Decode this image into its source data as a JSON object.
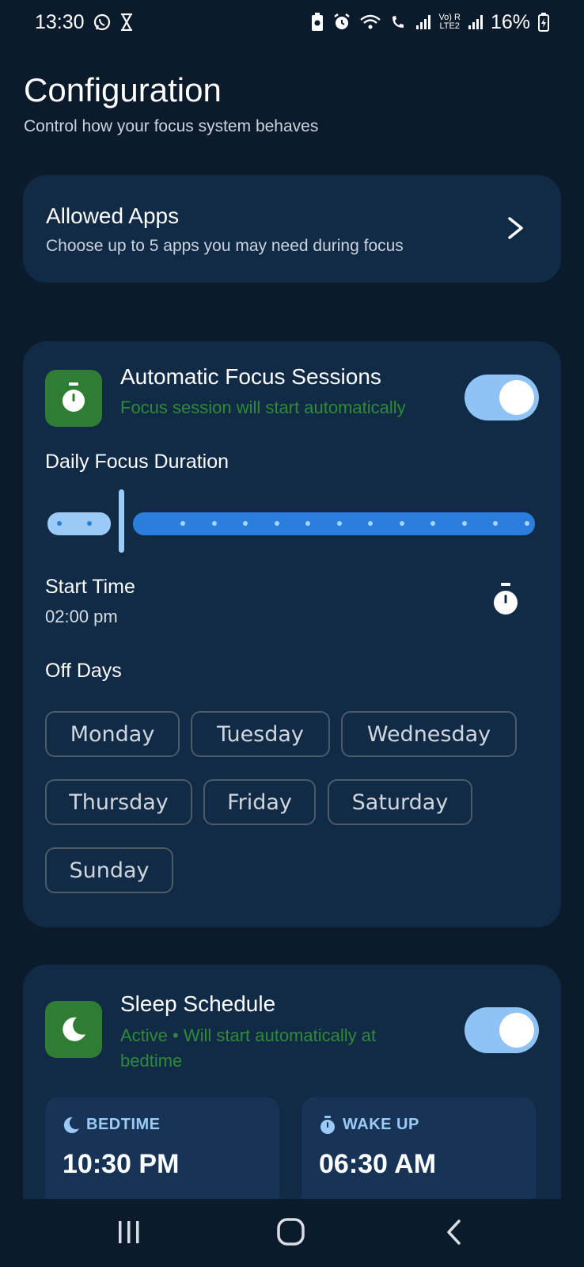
{
  "status_bar": {
    "time": "13:30",
    "battery": "16%",
    "network_label_top": "Vo) R",
    "network_label_bottom": "LTE2",
    "icons": [
      "whatsapp-icon",
      "hourglass-icon",
      "battery-saver-icon",
      "alarm-icon",
      "wifi-icon",
      "wifi-calling-icon",
      "signal-icon",
      "signal-icon",
      "battery-charging-icon"
    ]
  },
  "header": {
    "title": "Configuration",
    "subtitle": "Control how your focus system behaves"
  },
  "allowed_apps": {
    "title": "Allowed Apps",
    "subtitle": "Choose up to 5 apps you may need during focus",
    "icon": "chevron-right-icon"
  },
  "focus": {
    "title": "Automatic Focus Sessions",
    "status": "Focus session will start automatically",
    "enabled": true,
    "icon": "stopwatch-icon",
    "duration_label": "Daily Focus Duration",
    "duration_fraction": 0.15,
    "start_time_label": "Start Time",
    "start_time_value": "02:00 pm",
    "off_days_label": "Off Days",
    "days": [
      "Monday",
      "Tuesday",
      "Wednesday",
      "Thursday",
      "Friday",
      "Saturday",
      "Sunday"
    ]
  },
  "sleep": {
    "title": "Sleep Schedule",
    "status": "Active • Will start automatically at bedtime",
    "enabled": true,
    "icon": "moon-icon",
    "bedtime_label": "BEDTIME",
    "bedtime_value": "10:30 PM",
    "wakeup_label": "WAKE UP",
    "wakeup_value": "06:30 AM"
  },
  "colors": {
    "background": "#0c1b2b",
    "card": "#112a45",
    "accent_green": "#2f7d32",
    "status_green": "#2f8a36",
    "toggle_on": "#8fc2f5",
    "slider_active": "#2a7fde"
  },
  "nav_bar": {
    "icons": [
      "recent-apps-icon",
      "home-icon",
      "back-icon"
    ]
  }
}
